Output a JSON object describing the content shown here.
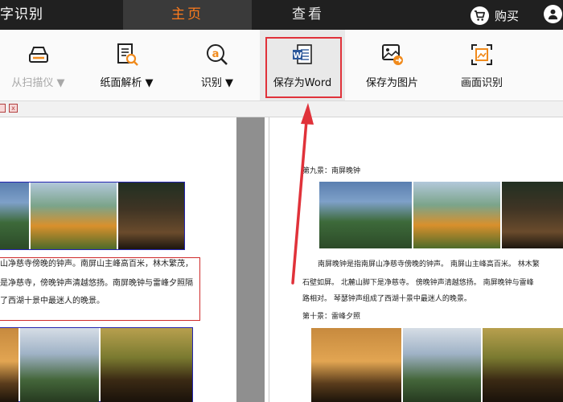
{
  "header": {
    "app_title": "字识别",
    "tabs": [
      {
        "label": "主页",
        "active": true
      },
      {
        "label": "查看",
        "active": false
      }
    ],
    "buy_label": "购买"
  },
  "toolbar": {
    "items": [
      {
        "label": "从扫描仪 ▼",
        "enabled": false,
        "icon": "scanner-icon"
      },
      {
        "label": "纸面解析 ▼",
        "enabled": true,
        "icon": "document-search-icon"
      },
      {
        "label": "识别 ▼",
        "enabled": true,
        "icon": "recognize-icon"
      },
      {
        "label": "保存为Word",
        "enabled": true,
        "icon": "word-document-icon",
        "highlighted": true
      },
      {
        "label": "保存为图片",
        "enabled": true,
        "icon": "save-image-icon"
      },
      {
        "label": "画面识别",
        "enabled": true,
        "icon": "screen-capture-icon"
      }
    ]
  },
  "left_doc": {
    "lines": [
      "山净慈寺傍晚的钟声。南屏山主峰高百米，林木繁茂，",
      "是净慈寺，傍晚钟声清越悠扬。南屏晚钟与雷峰夕照隔",
      "了西湖十景中最迷人的晚景。"
    ]
  },
  "right_doc": {
    "heading1": "第九景：南屏晚钟",
    "lines": [
      "南屏晚钟是指南屏山净慈寺傍晚的钟声。 南屏山主峰高百米。 林木繁",
      "石壁如屏。 北麓山脚下是净慈寺。 傍晚钟声清越悠扬。 南屏晚钟与雷峰",
      "路相对。 琴瑟钟声组成了西湖十景中最迷人的晚景。"
    ],
    "heading2": "第十景：雷峰夕照"
  },
  "colors": {
    "topbar_bg": "#202020",
    "active_tab": "#ff7b1c",
    "highlight": "#e0323a",
    "word_blue": "#2b579a"
  }
}
